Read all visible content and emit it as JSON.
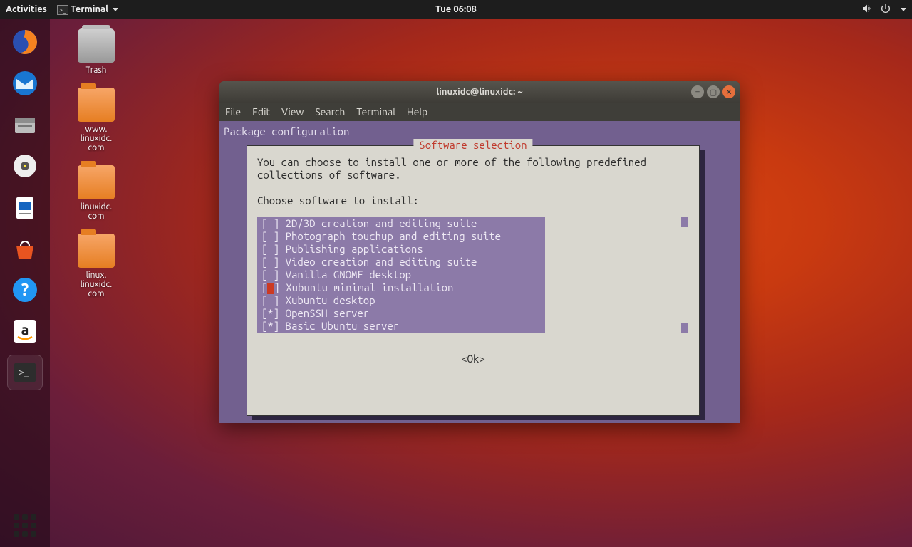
{
  "topbar": {
    "activities": "Activities",
    "app_label": "Terminal",
    "clock": "Tue 06:08"
  },
  "dock": {
    "items": [
      "firefox",
      "thunderbird",
      "files",
      "rhythmbox",
      "writer",
      "software",
      "amazon",
      "help",
      "terminal"
    ]
  },
  "desktop": {
    "icons": [
      {
        "type": "trash",
        "label": "Trash"
      },
      {
        "type": "folder",
        "label": "www.\nlinuxidc.\ncom"
      },
      {
        "type": "folder",
        "label": "linuxidc.\ncom"
      },
      {
        "type": "folder",
        "label": "linux.\nlinuxidc.\ncom"
      }
    ]
  },
  "window": {
    "title": "linuxidc@linuxidc: ~",
    "menu": [
      "File",
      "Edit",
      "View",
      "Search",
      "Terminal",
      "Help"
    ],
    "package_line": "Package configuration",
    "dialog": {
      "title": "Software selection",
      "intro": "You can choose to install one or more of the following predefined\ncollections of software.\n\nChoose software to install:",
      "items": [
        {
          "mark": " ",
          "label": "2D/3D creation and editing suite",
          "cursor": false
        },
        {
          "mark": " ",
          "label": "Photograph touchup and editing suite",
          "cursor": false
        },
        {
          "mark": " ",
          "label": "Publishing applications",
          "cursor": false
        },
        {
          "mark": " ",
          "label": "Video creation and editing suite",
          "cursor": false
        },
        {
          "mark": " ",
          "label": "Vanilla GNOME desktop",
          "cursor": false
        },
        {
          "mark": " ",
          "label": "Xubuntu minimal installation",
          "cursor": true
        },
        {
          "mark": " ",
          "label": "Xubuntu desktop",
          "cursor": false
        },
        {
          "mark": "*",
          "label": "OpenSSH server",
          "cursor": false
        },
        {
          "mark": "*",
          "label": "Basic Ubuntu server",
          "cursor": false
        }
      ],
      "ok": "<Ok>"
    }
  }
}
